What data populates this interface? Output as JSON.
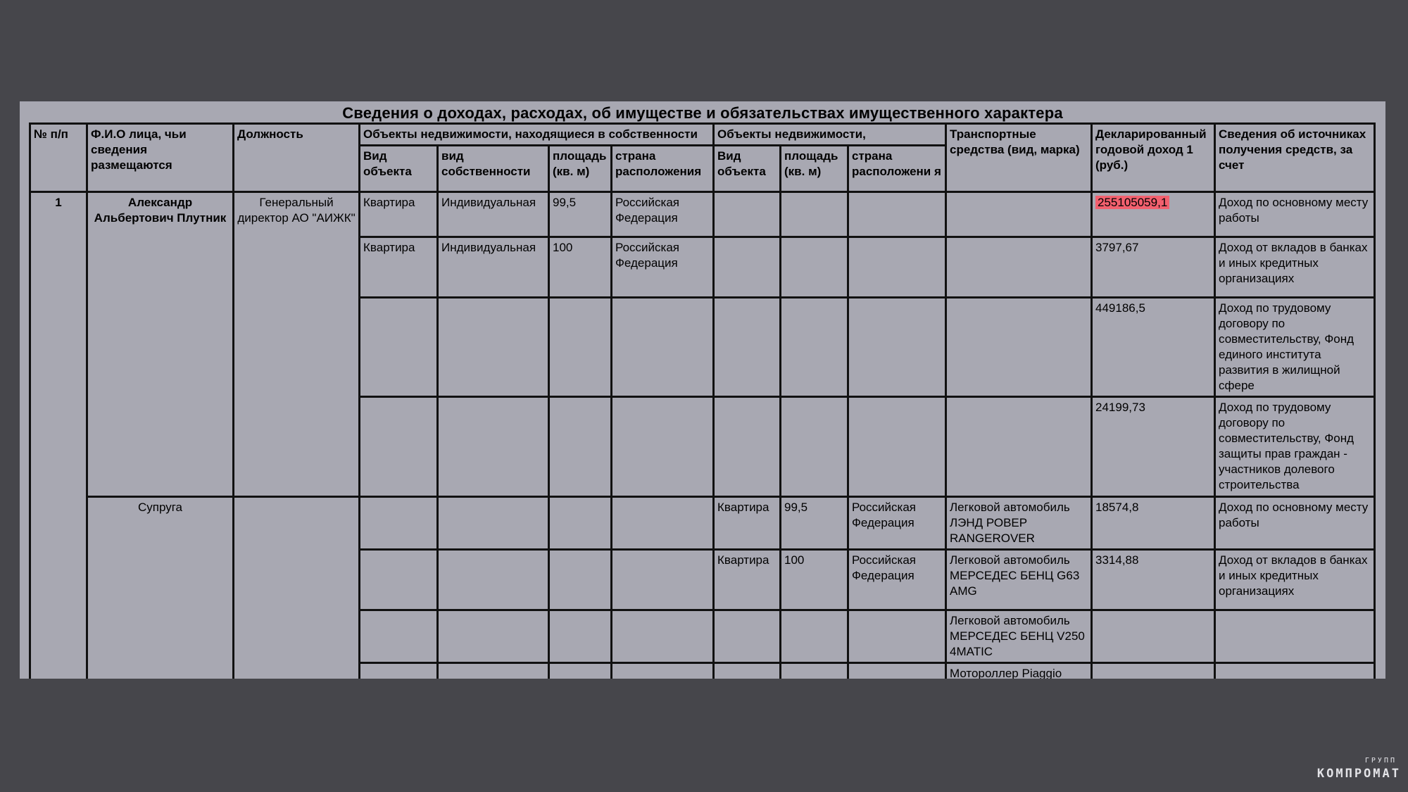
{
  "document": {
    "title": "Сведения о доходах, расходах, об имуществе и обязательствах имущественного характера"
  },
  "headers": {
    "num": "№ п/п",
    "name": "Ф.И.О лица, чьи сведения размещаются",
    "position": "Должность",
    "owned_group": "Объекты недвижимости, находящиеся в собственности",
    "used_group": "Объекты недвижимости,",
    "vehicles": "Транспортные средства (вид, марка)",
    "income": "Декларированный годовой доход 1 (руб.)",
    "sources": "Сведения об источниках получения средств, за счет",
    "obj_type": "Вид объекта",
    "ownership": "вид собственности",
    "area": "площадь (кв. м)",
    "country": "страна расположения",
    "obj_type2": "Вид объекта",
    "area2": "площадь (кв. м)",
    "country2": "страна расположени я"
  },
  "person": {
    "num": "1",
    "name": "Александр Альбертович Плутник",
    "position": "Генеральный директор АО \"АИЖК\""
  },
  "spouse": {
    "label": "Супруга"
  },
  "rows": [
    {
      "obj_type": "Квартира",
      "ownership": "Индивидуальная",
      "area": "99,5",
      "country": "Российская Федерация",
      "obj_type2": "",
      "area2": "",
      "country2": "",
      "vehicle": "",
      "income": "255105059,1",
      "source": "Доход по основному месту работы"
    },
    {
      "obj_type": "Квартира",
      "ownership": "Индивидуальная",
      "area": "100",
      "country": "Российская Федерация",
      "obj_type2": "",
      "area2": "",
      "country2": "",
      "vehicle": "",
      "income": "3797,67",
      "source": "Доход от вкладов в банках и иных кредитных организациях"
    },
    {
      "obj_type": "",
      "ownership": "",
      "area": "",
      "country": "",
      "obj_type2": "",
      "area2": "",
      "country2": "",
      "vehicle": "",
      "income": "449186,5",
      "source": "Доход по трудовому договору по совместительству, Фонд единого института развития в жилищной сфере"
    },
    {
      "obj_type": "",
      "ownership": "",
      "area": "",
      "country": "",
      "obj_type2": "",
      "area2": "",
      "country2": "",
      "vehicle": "",
      "income": "24199,73",
      "source": "Доход по трудовому договору по совместительству, Фонд защиты прав граждан - участников долевого строительства"
    },
    {
      "obj_type": "",
      "ownership": "",
      "area": "",
      "country": "",
      "obj_type2": "Квартира",
      "area2": "99,5",
      "country2": "Российская Федерация",
      "vehicle": "Легковой автомобиль ЛЭНД РОВЕР RANGEROVER",
      "income": "18574,8",
      "source": "Доход по основному месту работы"
    },
    {
      "obj_type": "",
      "ownership": "",
      "area": "",
      "country": "",
      "obj_type2": "Квартира",
      "area2": "100",
      "country2": "Российская Федерация",
      "vehicle": "Легковой автомобиль МЕРСЕДЕС БЕНЦ G63 AMG",
      "income": "3314,88",
      "source": "Доход от вкладов в банках и иных кредитных организациях"
    },
    {
      "obj_type": "",
      "ownership": "",
      "area": "",
      "country": "",
      "obj_type2": "",
      "area2": "",
      "country2": "",
      "vehicle": "Легковой автомобиль МЕРСЕДЕС БЕНЦ V250 4MATIC",
      "income": "",
      "source": ""
    },
    {
      "obj_type": "",
      "ownership": "",
      "area": "",
      "country": "",
      "obj_type2": "",
      "area2": "",
      "country2": "",
      "vehicle": "Мотороллер Piaggio Vespa GTS Super",
      "income": "",
      "source": ""
    }
  ],
  "highlight_color": "#f2606e",
  "watermark": {
    "main": "КОМПРОМАТ",
    "small": "ГРУПП"
  }
}
